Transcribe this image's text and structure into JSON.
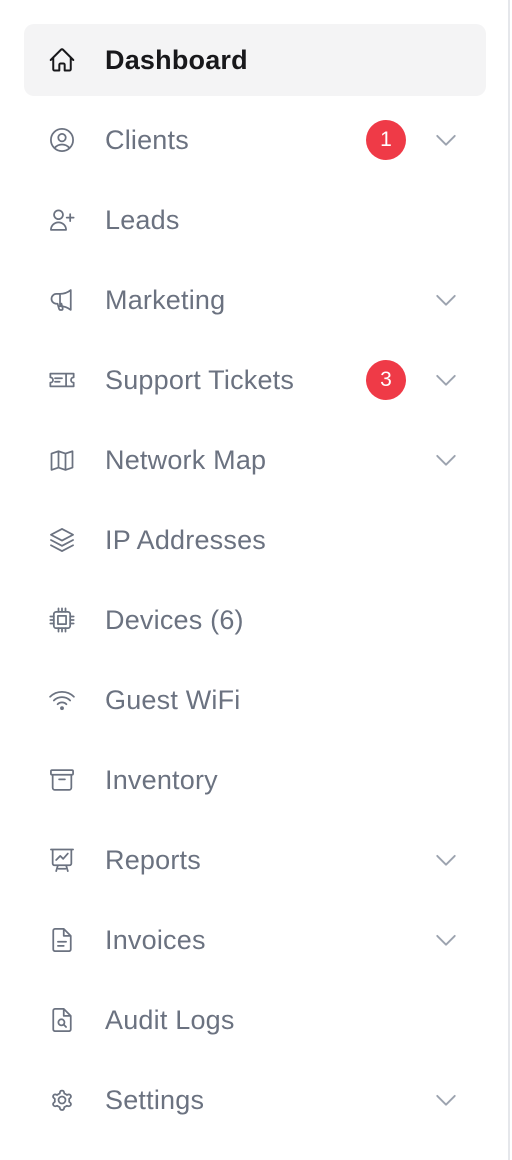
{
  "colors": {
    "active_background": "#f4f4f5",
    "active_text": "#18181b",
    "inactive_text": "#6b7280",
    "badge": "#ef3a47",
    "chevron": "#9ca3af"
  },
  "nav": {
    "items": [
      {
        "label": "Dashboard",
        "icon": "home-icon",
        "active": true
      },
      {
        "label": "Clients",
        "icon": "user-circle-icon",
        "badge": "1",
        "expandable": true
      },
      {
        "label": "Leads",
        "icon": "user-plus-icon"
      },
      {
        "label": "Marketing",
        "icon": "megaphone-icon",
        "expandable": true
      },
      {
        "label": "Support Tickets",
        "icon": "ticket-icon",
        "badge": "3",
        "expandable": true
      },
      {
        "label": "Network Map",
        "icon": "map-icon",
        "expandable": true
      },
      {
        "label": "IP Addresses",
        "icon": "layers-icon"
      },
      {
        "label": "Devices (6)",
        "icon": "cpu-chip-icon"
      },
      {
        "label": "Guest WiFi",
        "icon": "wifi-icon"
      },
      {
        "label": "Inventory",
        "icon": "archive-box-icon"
      },
      {
        "label": "Reports",
        "icon": "presentation-chart-icon",
        "expandable": true
      },
      {
        "label": "Invoices",
        "icon": "document-text-icon",
        "expandable": true
      },
      {
        "label": "Audit Logs",
        "icon": "document-search-icon"
      },
      {
        "label": "Settings",
        "icon": "cog-icon",
        "expandable": true
      }
    ]
  }
}
